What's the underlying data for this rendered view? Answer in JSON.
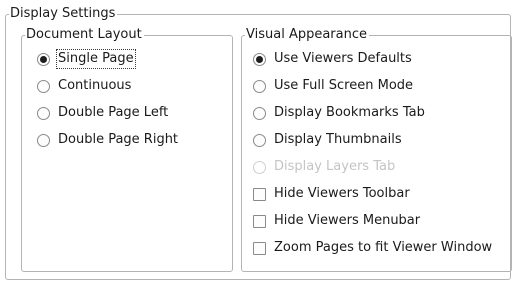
{
  "display_settings": {
    "title": "Display Settings",
    "document_layout": {
      "title": "Document Layout",
      "options": [
        {
          "label": "Single Page",
          "checked": true,
          "focused": true
        },
        {
          "label": "Continuous",
          "checked": false
        },
        {
          "label": "Double Page Left",
          "checked": false
        },
        {
          "label": "Double Page Right",
          "checked": false
        }
      ]
    },
    "visual_appearance": {
      "title": "Visual Appearance",
      "radios": [
        {
          "label": "Use Viewers Defaults",
          "checked": true
        },
        {
          "label": "Use Full Screen Mode",
          "checked": false
        },
        {
          "label": "Display Bookmarks Tab",
          "checked": false
        },
        {
          "label": "Display Thumbnails",
          "checked": false
        },
        {
          "label": "Display Layers Tab",
          "checked": false,
          "disabled": true
        }
      ],
      "checkboxes": [
        {
          "label": "Hide Viewers Toolbar",
          "checked": false
        },
        {
          "label": "Hide Viewers Menubar",
          "checked": false
        },
        {
          "label": "Zoom Pages to fit Viewer Window",
          "checked": false
        }
      ]
    }
  }
}
